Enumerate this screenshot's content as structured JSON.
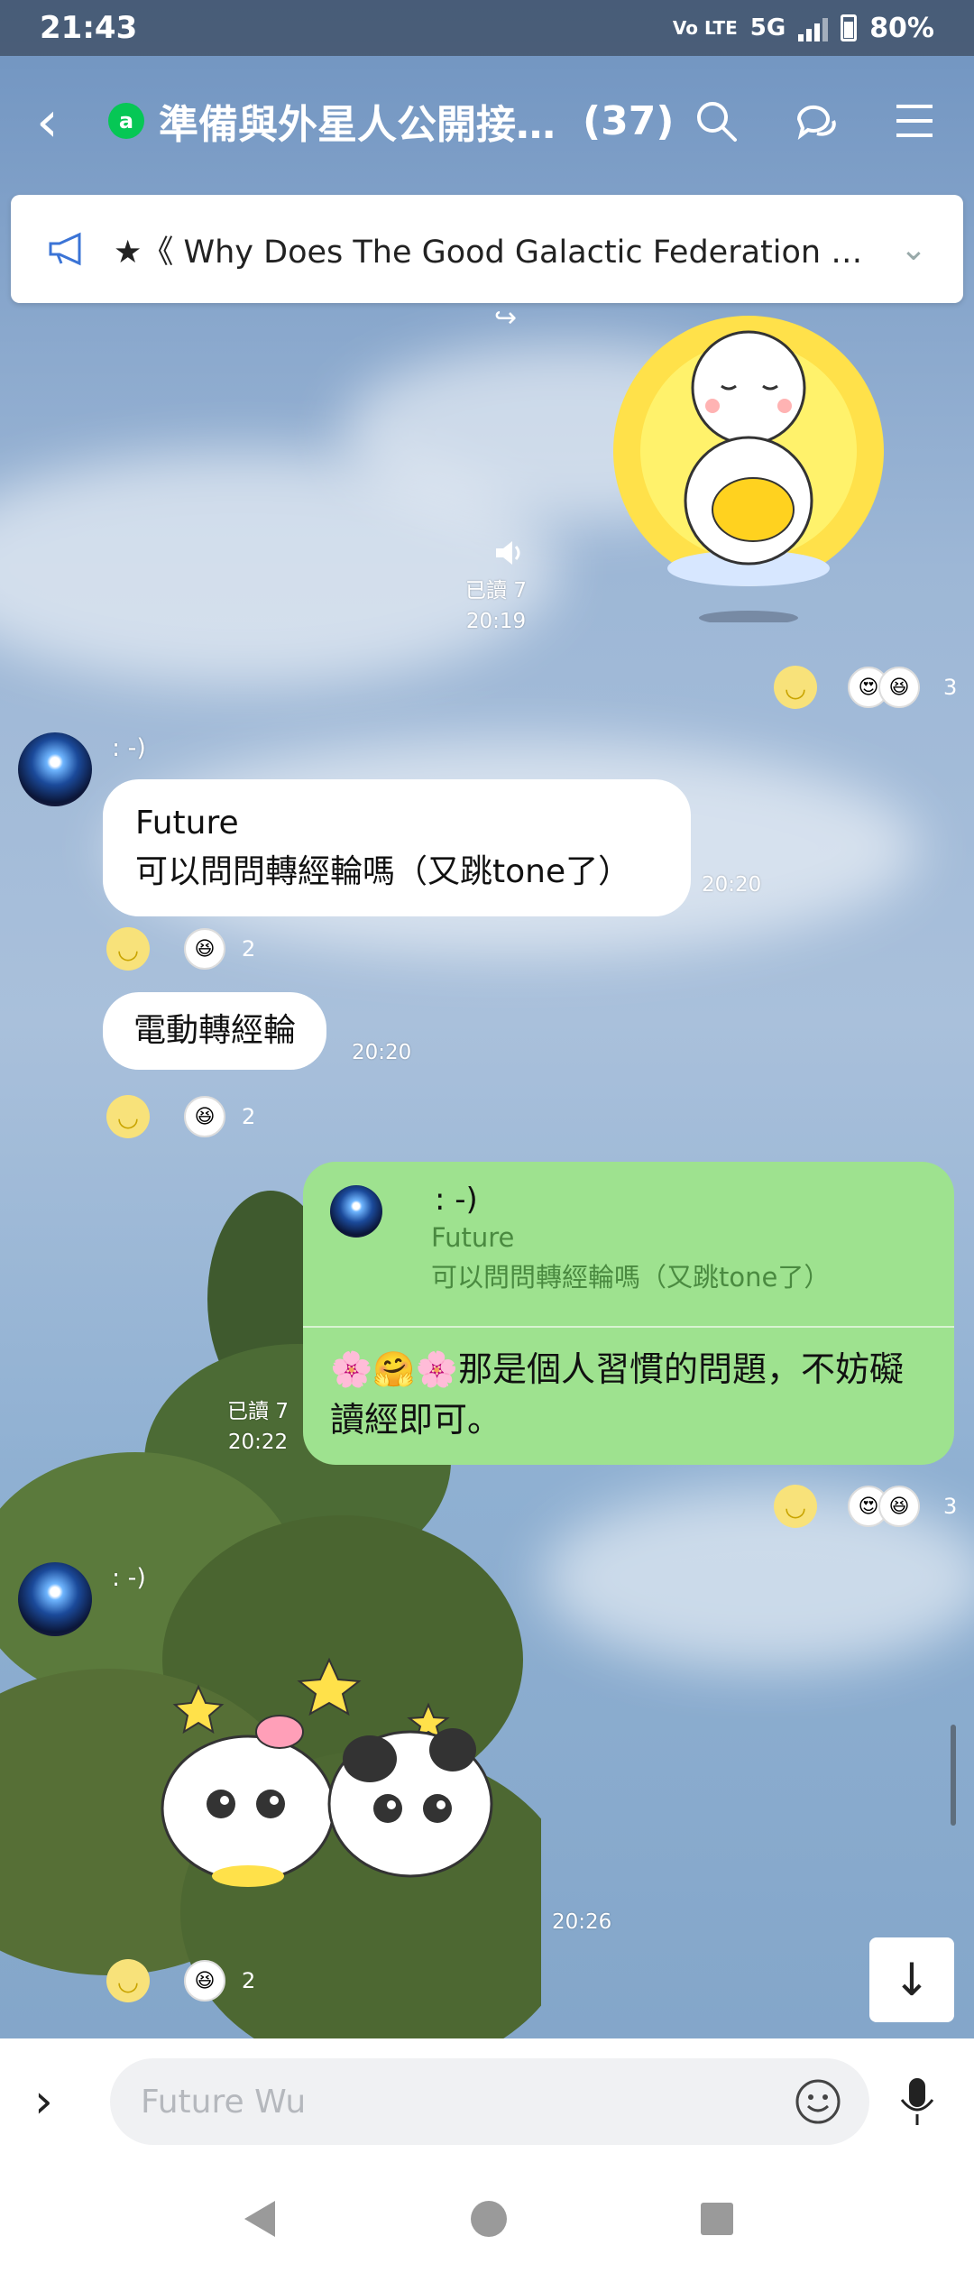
{
  "status": {
    "time": "21:43",
    "network": "5G",
    "lte": "Vo LTE",
    "battery": "80%"
  },
  "header": {
    "title": "準備與外星人公開接…",
    "count": "(37)",
    "group_badge": "a"
  },
  "announcement": {
    "text": "★《 Why Does The Good Galactic Federation N…"
  },
  "messages": {
    "m1": {
      "read": "已讀 7",
      "time": "20:19",
      "reactions_count": "3"
    },
    "m2": {
      "sender": ": -)",
      "line1": "Future",
      "line2": "可以問問轉經輪嗎（又跳tone了）",
      "time": "20:20",
      "reactions_count": "2"
    },
    "m3": {
      "text": "電動轉經輪",
      "time": "20:20",
      "reactions_count": "2"
    },
    "m4": {
      "quote_sender": ": -)",
      "quote_name": "Future",
      "quote_text": "可以問問轉經輪嗎（又跳tone了）",
      "reply_line1": "🌸🤗🌸那是個人習慣的問題，不妨礙",
      "reply_line2": "讀經即可。",
      "read": "已讀 7",
      "time": "20:22",
      "reactions_count": "3"
    },
    "m5": {
      "sender": ": -)",
      "time": "20:26",
      "reactions_count": "2"
    }
  },
  "input": {
    "placeholder": "Future Wu"
  },
  "colors": {
    "line_green": "#06c755",
    "bubble_green": "#9ee28f"
  }
}
